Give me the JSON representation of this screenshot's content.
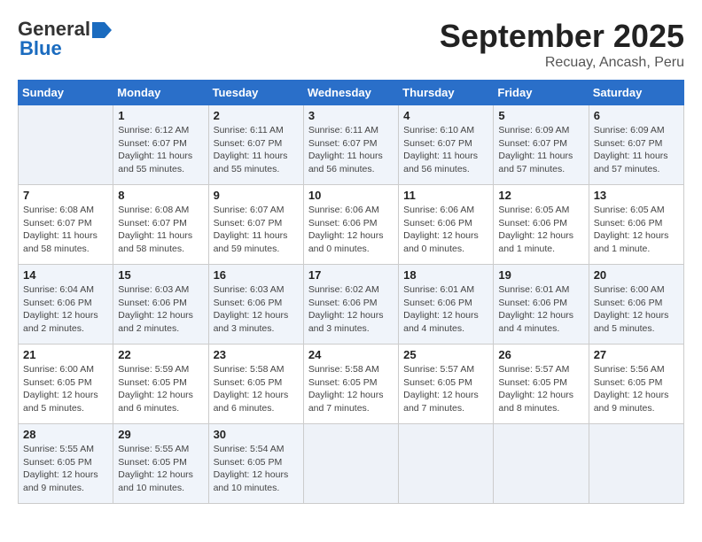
{
  "logo": {
    "line1": "General",
    "line2": "Blue"
  },
  "title": "September 2025",
  "subtitle": "Recuay, Ancash, Peru",
  "headers": [
    "Sunday",
    "Monday",
    "Tuesday",
    "Wednesday",
    "Thursday",
    "Friday",
    "Saturday"
  ],
  "weeks": [
    [
      {
        "day": "",
        "info": ""
      },
      {
        "day": "1",
        "info": "Sunrise: 6:12 AM\nSunset: 6:07 PM\nDaylight: 11 hours\nand 55 minutes."
      },
      {
        "day": "2",
        "info": "Sunrise: 6:11 AM\nSunset: 6:07 PM\nDaylight: 11 hours\nand 55 minutes."
      },
      {
        "day": "3",
        "info": "Sunrise: 6:11 AM\nSunset: 6:07 PM\nDaylight: 11 hours\nand 56 minutes."
      },
      {
        "day": "4",
        "info": "Sunrise: 6:10 AM\nSunset: 6:07 PM\nDaylight: 11 hours\nand 56 minutes."
      },
      {
        "day": "5",
        "info": "Sunrise: 6:09 AM\nSunset: 6:07 PM\nDaylight: 11 hours\nand 57 minutes."
      },
      {
        "day": "6",
        "info": "Sunrise: 6:09 AM\nSunset: 6:07 PM\nDaylight: 11 hours\nand 57 minutes."
      }
    ],
    [
      {
        "day": "7",
        "info": "Sunrise: 6:08 AM\nSunset: 6:07 PM\nDaylight: 11 hours\nand 58 minutes."
      },
      {
        "day": "8",
        "info": "Sunrise: 6:08 AM\nSunset: 6:07 PM\nDaylight: 11 hours\nand 58 minutes."
      },
      {
        "day": "9",
        "info": "Sunrise: 6:07 AM\nSunset: 6:07 PM\nDaylight: 11 hours\nand 59 minutes."
      },
      {
        "day": "10",
        "info": "Sunrise: 6:06 AM\nSunset: 6:06 PM\nDaylight: 12 hours\nand 0 minutes."
      },
      {
        "day": "11",
        "info": "Sunrise: 6:06 AM\nSunset: 6:06 PM\nDaylight: 12 hours\nand 0 minutes."
      },
      {
        "day": "12",
        "info": "Sunrise: 6:05 AM\nSunset: 6:06 PM\nDaylight: 12 hours\nand 1 minute."
      },
      {
        "day": "13",
        "info": "Sunrise: 6:05 AM\nSunset: 6:06 PM\nDaylight: 12 hours\nand 1 minute."
      }
    ],
    [
      {
        "day": "14",
        "info": "Sunrise: 6:04 AM\nSunset: 6:06 PM\nDaylight: 12 hours\nand 2 minutes."
      },
      {
        "day": "15",
        "info": "Sunrise: 6:03 AM\nSunset: 6:06 PM\nDaylight: 12 hours\nand 2 minutes."
      },
      {
        "day": "16",
        "info": "Sunrise: 6:03 AM\nSunset: 6:06 PM\nDaylight: 12 hours\nand 3 minutes."
      },
      {
        "day": "17",
        "info": "Sunrise: 6:02 AM\nSunset: 6:06 PM\nDaylight: 12 hours\nand 3 minutes."
      },
      {
        "day": "18",
        "info": "Sunrise: 6:01 AM\nSunset: 6:06 PM\nDaylight: 12 hours\nand 4 minutes."
      },
      {
        "day": "19",
        "info": "Sunrise: 6:01 AM\nSunset: 6:06 PM\nDaylight: 12 hours\nand 4 minutes."
      },
      {
        "day": "20",
        "info": "Sunrise: 6:00 AM\nSunset: 6:06 PM\nDaylight: 12 hours\nand 5 minutes."
      }
    ],
    [
      {
        "day": "21",
        "info": "Sunrise: 6:00 AM\nSunset: 6:05 PM\nDaylight: 12 hours\nand 5 minutes."
      },
      {
        "day": "22",
        "info": "Sunrise: 5:59 AM\nSunset: 6:05 PM\nDaylight: 12 hours\nand 6 minutes."
      },
      {
        "day": "23",
        "info": "Sunrise: 5:58 AM\nSunset: 6:05 PM\nDaylight: 12 hours\nand 6 minutes."
      },
      {
        "day": "24",
        "info": "Sunrise: 5:58 AM\nSunset: 6:05 PM\nDaylight: 12 hours\nand 7 minutes."
      },
      {
        "day": "25",
        "info": "Sunrise: 5:57 AM\nSunset: 6:05 PM\nDaylight: 12 hours\nand 7 minutes."
      },
      {
        "day": "26",
        "info": "Sunrise: 5:57 AM\nSunset: 6:05 PM\nDaylight: 12 hours\nand 8 minutes."
      },
      {
        "day": "27",
        "info": "Sunrise: 5:56 AM\nSunset: 6:05 PM\nDaylight: 12 hours\nand 9 minutes."
      }
    ],
    [
      {
        "day": "28",
        "info": "Sunrise: 5:55 AM\nSunset: 6:05 PM\nDaylight: 12 hours\nand 9 minutes."
      },
      {
        "day": "29",
        "info": "Sunrise: 5:55 AM\nSunset: 6:05 PM\nDaylight: 12 hours\nand 10 minutes."
      },
      {
        "day": "30",
        "info": "Sunrise: 5:54 AM\nSunset: 6:05 PM\nDaylight: 12 hours\nand 10 minutes."
      },
      {
        "day": "",
        "info": ""
      },
      {
        "day": "",
        "info": ""
      },
      {
        "day": "",
        "info": ""
      },
      {
        "day": "",
        "info": ""
      }
    ]
  ]
}
